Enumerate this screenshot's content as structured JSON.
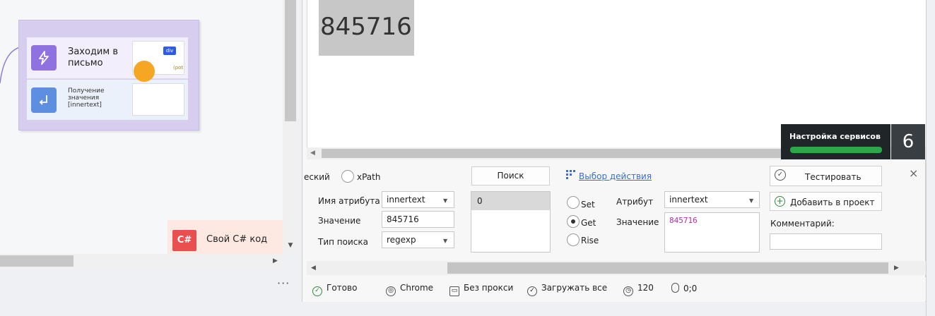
{
  "canvas": {
    "group_step1_label": "Заходим в письмо",
    "group_step2_label": "Получение значения [innertext]",
    "thumb_badge": "div",
    "thumb_tag": "(pot",
    "csharp_icon": "C#",
    "csharp_label": "Свой C# код",
    "more_dots": "···"
  },
  "browser": {
    "highlighted_value": "845716"
  },
  "services": {
    "label": "Настройка сервисов",
    "count": "6",
    "progress_fraction": 1.0
  },
  "toolbar": {
    "mode_clipped": "еский",
    "xpath_label": "xPath",
    "search_button": "Поиск",
    "action_link": "Выбор действия",
    "test_button": "Тестировать",
    "add_button": "Добавить в проект",
    "close_icon": "×"
  },
  "form": {
    "attr_name_label": "Имя атрибута",
    "attr_name_value": "innertext",
    "value_label": "Значение",
    "value_value": "845716",
    "search_type_label": "Тип поиска",
    "search_type_value": "regexp",
    "results": [
      "0"
    ],
    "set_label": "Set",
    "get_label": "Get",
    "rise_label": "Rise",
    "selected_radio": "Get",
    "attribute_label": "Атрибут",
    "attribute_value": "innertext",
    "value2_label": "Значение",
    "value2_value": "845716",
    "comment_label": "Комментарий:",
    "comment_value": ""
  },
  "status": {
    "ready": "Готово",
    "browser": "Chrome",
    "proxy": "Без прокси",
    "load": "Загружать все",
    "timeout": "120",
    "coords": "0;0"
  },
  "colors": {
    "group_bg": "#d7cdef",
    "bolt_icon": "#8f71e0",
    "down_icon": "#5d8fe0",
    "csharp": "#ea4f4f",
    "progress": "#2ea64a",
    "link": "#3d6bcf",
    "value_text": "#b02ea6"
  }
}
